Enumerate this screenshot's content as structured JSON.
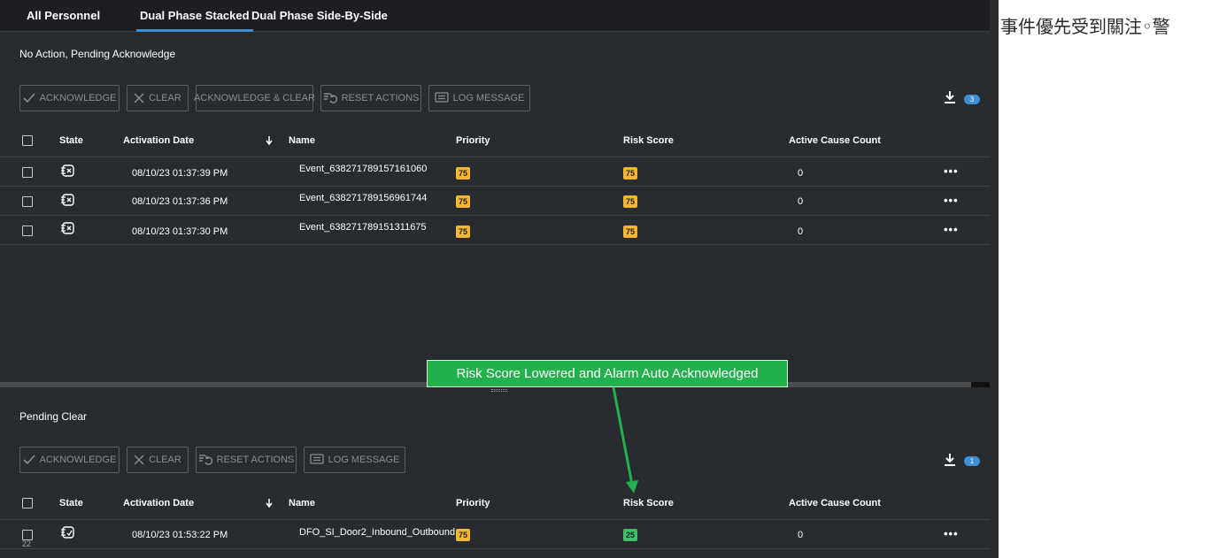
{
  "tabs": [
    "All Personnel",
    "Dual Phase Stacked",
    "Dual Phase Side-By-Side"
  ],
  "top_section": {
    "title": "No Action, Pending Acknowledge",
    "buttons": {
      "acknowledge": "ACKNOWLEDGE",
      "clear": "CLEAR",
      "ack_clear": "ACKNOWLEDGE & CLEAR",
      "reset": "RESET ACTIONS",
      "log": "LOG MESSAGE"
    },
    "badge_count": "3",
    "columns": {
      "state": "State",
      "activation_date": "Activation Date",
      "name": "Name",
      "priority": "Priority",
      "risk_score": "Risk Score",
      "active_cause_count": "Active Cause Count"
    },
    "rows": [
      {
        "date": "08/10/23 01:37:39 PM",
        "name": "Event_638271789157161060",
        "priority": "75",
        "risk": "75",
        "count": "0"
      },
      {
        "date": "08/10/23 01:37:36 PM",
        "name": "Event_638271789156961744",
        "priority": "75",
        "risk": "75",
        "count": "0"
      },
      {
        "date": "08/10/23 01:37:30 PM",
        "name": "Event_638271789151311675",
        "priority": "75",
        "risk": "75",
        "count": "0"
      }
    ]
  },
  "bottom_section": {
    "title": "Pending Clear",
    "buttons": {
      "acknowledge": "ACKNOWLEDGE",
      "clear": "CLEAR",
      "reset": "RESET ACTIONS",
      "log": "LOG MESSAGE"
    },
    "badge_count": "1",
    "columns": {
      "state": "State",
      "activation_date": "Activation Date",
      "name": "Name",
      "priority": "Priority",
      "risk_score": "Risk Score",
      "active_cause_count": "Active Cause Count"
    },
    "rows": [
      {
        "date": "08/10/23 01:53:22 PM",
        "name": "DFO_SI_Door2_Inbound_Outbound",
        "priority": "75",
        "risk": "25",
        "count": "0"
      }
    ],
    "row_number": "22"
  },
  "callout": "Risk Score Lowered and Alarm Auto Acknowledged",
  "side_text": "事件優先受到關注◦警",
  "colors": {
    "background": "#282b30",
    "accent_blue": "#3f8fd6",
    "priority_orange": "#f5b731",
    "risk_high_orange": "#f5b731",
    "risk_low_green": "#3fbf6a",
    "callout_green": "#22b14c"
  }
}
